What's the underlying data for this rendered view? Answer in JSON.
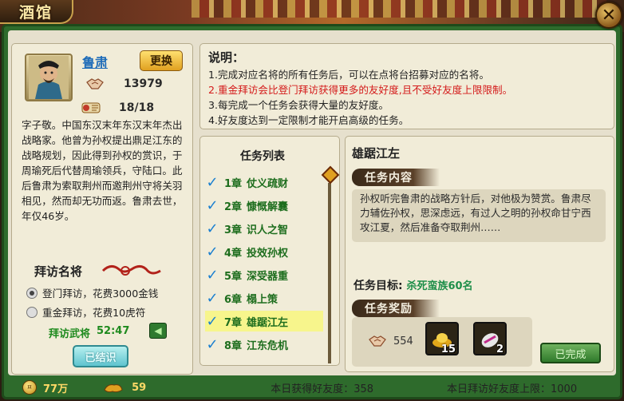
{
  "window": {
    "title": "酒馆",
    "close_label": "✕"
  },
  "general": {
    "name": "鲁肃",
    "change_label": "更换",
    "friendship": "13979",
    "visits": "18/18",
    "bio": "字子敬。中国东汉末年东汉末年杰出战略家。他曾为孙权提出鼎足江东的战略规划，因此得到孙权的赏识，于周瑜死后代替周瑜领兵，守陆口。此后鲁肃为索取荆州而邀荆州守将关羽相见，然而却无功而返。鲁肃去世，年仅46岁。"
  },
  "visit": {
    "title": "拜访名将",
    "option1": "登门拜访，花费3000金钱",
    "option2": "重金拜访，花费10虎符",
    "timer_label": "拜访武将",
    "timer_value": "52:47",
    "visited_label": "已结识"
  },
  "description": {
    "heading": "说明：",
    "lines": [
      "1.完成对应名将的所有任务后，可以在点将台招募对应的名将。",
      "2.重金拜访会比登门拜访获得更多的友好度,且不受好友度上限限制。",
      "3.每完成一个任务会获得大量的友好度。",
      "4.好友度达到一定限制才能开启高级的任务。"
    ]
  },
  "tasks": {
    "heading": "任务列表",
    "items": [
      {
        "chapter": "1章",
        "name": "仗义疏财"
      },
      {
        "chapter": "2章",
        "name": "慷慨解囊"
      },
      {
        "chapter": "3章",
        "name": "识人之智"
      },
      {
        "chapter": "4章",
        "name": "投效孙权"
      },
      {
        "chapter": "5章",
        "name": "深受器重"
      },
      {
        "chapter": "6章",
        "name": "榻上策"
      },
      {
        "chapter": "7章",
        "name": "雄踞江左"
      },
      {
        "chapter": "8章",
        "name": "江东危机"
      }
    ],
    "selected_index": 6
  },
  "detail": {
    "title": "雄踞江左",
    "content_ribbon": "任务内容",
    "content": "孙权听完鲁肃的战略方针后，对他极为赞赏。鲁肃尽力辅佐孙权，思深虑远，有过人之明的孙权命甘宁西攻江夏，然后准备夺取荆州……",
    "target_label": "任务目标:",
    "target_value": "杀死蛮族60名",
    "reward_ribbon": "任务奖励",
    "reward_friendship": "554",
    "reward_item1_qty": "15",
    "reward_item2_qty": "2",
    "done_label": "已完成"
  },
  "footer": {
    "gold": "77万",
    "tally": "59",
    "today_friendship": "本日获得好友度：358",
    "today_limit": "本日拜访好友度上限：1000"
  },
  "colors": {
    "frame_green": "#2e6b2c",
    "accent_red": "#d41a1a",
    "task_green": "#1e6e1e",
    "link_blue": "#1d6bb8"
  }
}
